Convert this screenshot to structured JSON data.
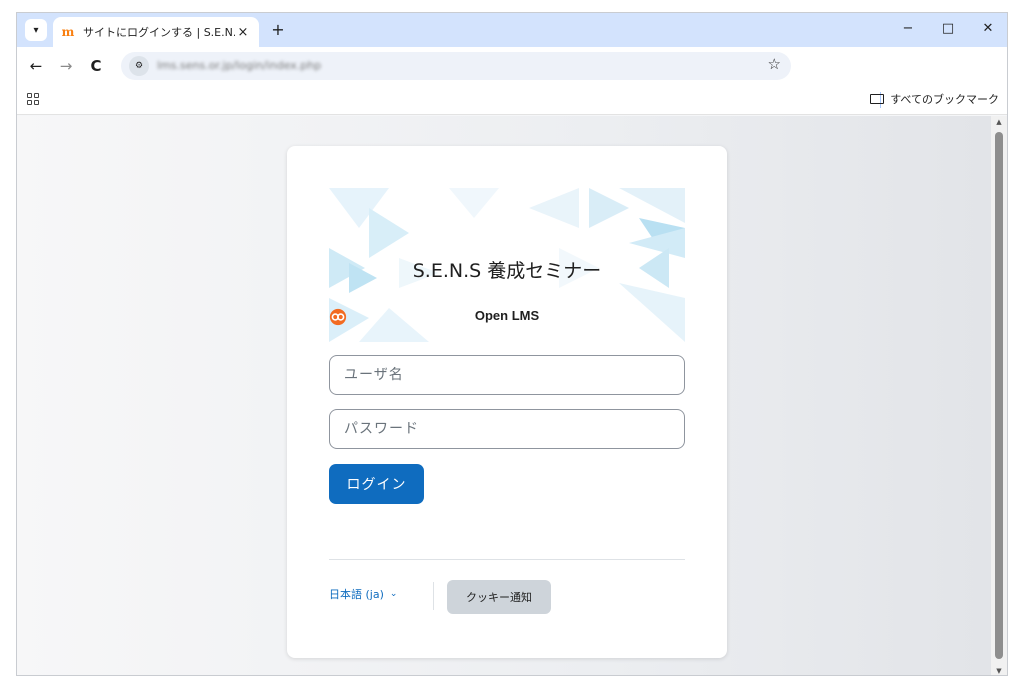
{
  "browser": {
    "tab": {
      "favicon": "moodle-icon",
      "title": "サイトにログインする | S.E.N.S",
      "close": "×"
    },
    "tab_menu_icon": "chevron-down-icon",
    "new_tab": "+",
    "window_controls": {
      "minimize": "−",
      "maximize": "□",
      "close": "✕"
    },
    "nav": {
      "back": "←",
      "forward": "→",
      "reload": "C"
    },
    "address": {
      "site_info_icon": "tune-icon",
      "url": "lms.sens.or.jp/login/index.php"
    },
    "bookmark_star": "☆",
    "bookmarks_bar": {
      "all_bookmarks": "すべてのブックマーク"
    }
  },
  "login": {
    "site_name": "S.E.N.S 養成セミナー",
    "brand": "Open LMS",
    "brand_color": "#f26b21",
    "username_placeholder": "ユーザ名",
    "password_placeholder": "パスワード",
    "login_button": "ログイン",
    "language": "日本語 (ja)",
    "cookie_button": "クッキー通知",
    "accent_color": "#0f6cbf"
  }
}
